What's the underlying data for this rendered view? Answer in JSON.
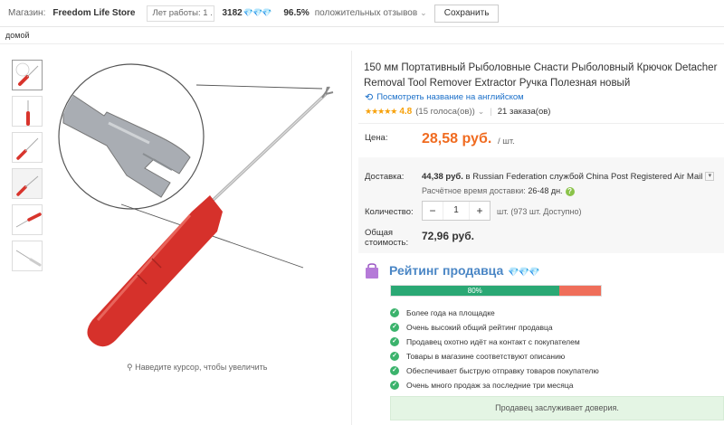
{
  "topbar": {
    "store_label": "Магазин:",
    "store_name": "Freedom Life Store",
    "years_label": "Лет работы: 1 .",
    "count": "3182",
    "diamonds": "💎💎💎",
    "percent": "96.5%",
    "positive_label": "положительных отзывов",
    "save_label": "Сохранить"
  },
  "breadcrumb": "домой",
  "product": {
    "title": "150 мм Портативный Рыболовные Снасти Рыболовный Крючок Detacher Removal Tool Remover Extractor Ручка Полезная новый",
    "english_link": "Посмотреть название на английском",
    "stars": "★★★★★",
    "rating": "4.8",
    "votes": "(15 голоса(ов))",
    "orders": "21 заказа(ов)",
    "zoom_hint": "Наведите курсор, чтобы увеличить"
  },
  "price": {
    "label": "Цена:",
    "value": "28,58 руб.",
    "unit": "/ шт."
  },
  "shipping": {
    "label": "Доставка:",
    "cost": "44,38 руб.",
    "text": " в Russian Federation службой China Post Registered Air Mail",
    "eta_label": "Расчётное время доставки:",
    "eta_value": "26-48 дн."
  },
  "quantity": {
    "label": "Количество:",
    "minus": "−",
    "value": "1",
    "plus": "+",
    "available": "шт. (973 шт. Доступно)"
  },
  "total": {
    "label": "Общая стоимость:",
    "value": "72,96 руб."
  },
  "seller_rating": {
    "title": "Рейтинг продавца",
    "diamonds": "💎💎💎",
    "percent_label": "80%",
    "percent": 0.8,
    "items": [
      "Более года на площадке",
      "Очень высокий общий рейтинг продавца",
      "Продавец охотно идёт на контакт с покупателем",
      "Товары в магазине соответствуют описанию",
      "Обеспечивает быструю отправку товаров покупателю",
      "Очень много продаж за последние три месяца"
    ],
    "trust": "Продавец заслуживает доверия."
  },
  "colors": {
    "accent": "#f06b20",
    "link": "#1a6fc9",
    "bar_green": "#2aa874",
    "bar_red": "#ef6e5a"
  }
}
